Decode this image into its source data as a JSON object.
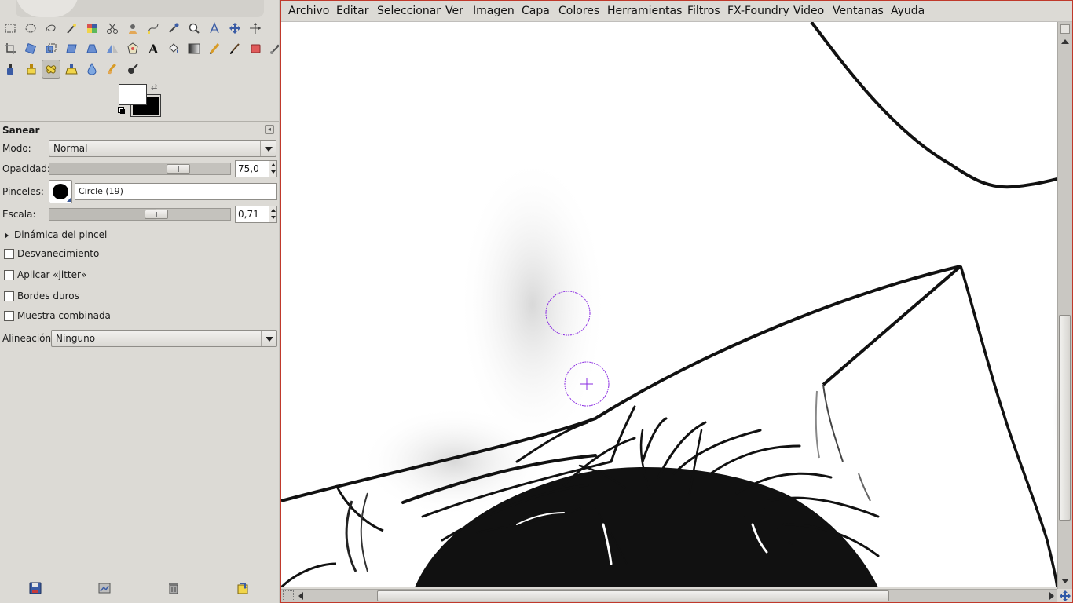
{
  "toolbox": {
    "tools": [
      {
        "name": "rect-select-icon"
      },
      {
        "name": "ellipse-select-icon"
      },
      {
        "name": "free-select-icon"
      },
      {
        "name": "fuzzy-select-icon"
      },
      {
        "name": "select-by-color-icon"
      },
      {
        "name": "scissors-icon"
      },
      {
        "name": "foreground-select-icon"
      },
      {
        "name": "paths-icon"
      },
      {
        "name": "color-picker-icon"
      },
      {
        "name": "zoom-icon"
      },
      {
        "name": "measure-icon"
      },
      {
        "name": "move-icon"
      },
      {
        "name": "align-icon"
      },
      {
        "name": "crop-icon"
      },
      {
        "name": "rotate-icon"
      },
      {
        "name": "scale-icon"
      },
      {
        "name": "shear-icon"
      },
      {
        "name": "perspective-icon"
      },
      {
        "name": "flip-icon"
      },
      {
        "name": "cage-icon"
      },
      {
        "name": "text-icon"
      },
      {
        "name": "bucket-fill-icon"
      },
      {
        "name": "blend-icon"
      },
      {
        "name": "pencil-icon"
      },
      {
        "name": "paintbrush-icon"
      },
      {
        "name": "eraser-icon"
      },
      {
        "name": "airbrush-icon"
      },
      {
        "name": "ink-icon"
      },
      {
        "name": "clone-icon"
      },
      {
        "name": "heal-icon"
      },
      {
        "name": "perspective-clone-icon"
      },
      {
        "name": "blur-sharpen-icon"
      },
      {
        "name": "smudge-icon"
      },
      {
        "name": "dodge-burn-icon"
      }
    ],
    "active_tool": "heal-icon",
    "colors": {
      "foreground": "#ffffff",
      "background": "#000000"
    }
  },
  "options": {
    "title": "Sanear",
    "mode_label": "Modo:",
    "mode_value": "Normal",
    "opacity_label": "Opacidad:",
    "opacity_value": "75,0",
    "opacity_fraction": 0.75,
    "brush_label": "Pinceles:",
    "brush_value": "Circle (19)",
    "scale_label": "Escala:",
    "scale_value": "0,71",
    "scale_fraction": 0.61,
    "dynamics_label": "Dinámica del pincel",
    "fade_label": "Desvanecimiento",
    "jitter_label": "Aplicar «jitter»",
    "hard_edges_label": "Bordes duros",
    "sample_merged_label": "Muestra combinada",
    "alignment_label": "Alineación:",
    "alignment_value": "Ninguno"
  },
  "menubar": {
    "items": [
      "Archivo",
      "Editar",
      "Seleccionar",
      "Ver",
      "Imagen",
      "Capa",
      "Colores",
      "Herramientas",
      "Filtros",
      "FX-Foundry",
      "Video",
      "Ventanas",
      "Ayuda"
    ]
  },
  "bottom_buttons": [
    "save-options-icon",
    "restore-options-icon",
    "delete-options-icon",
    "reset-options-icon"
  ],
  "accent": {
    "window_border": "#c0392b",
    "brush_outline": "#8a2be2"
  }
}
